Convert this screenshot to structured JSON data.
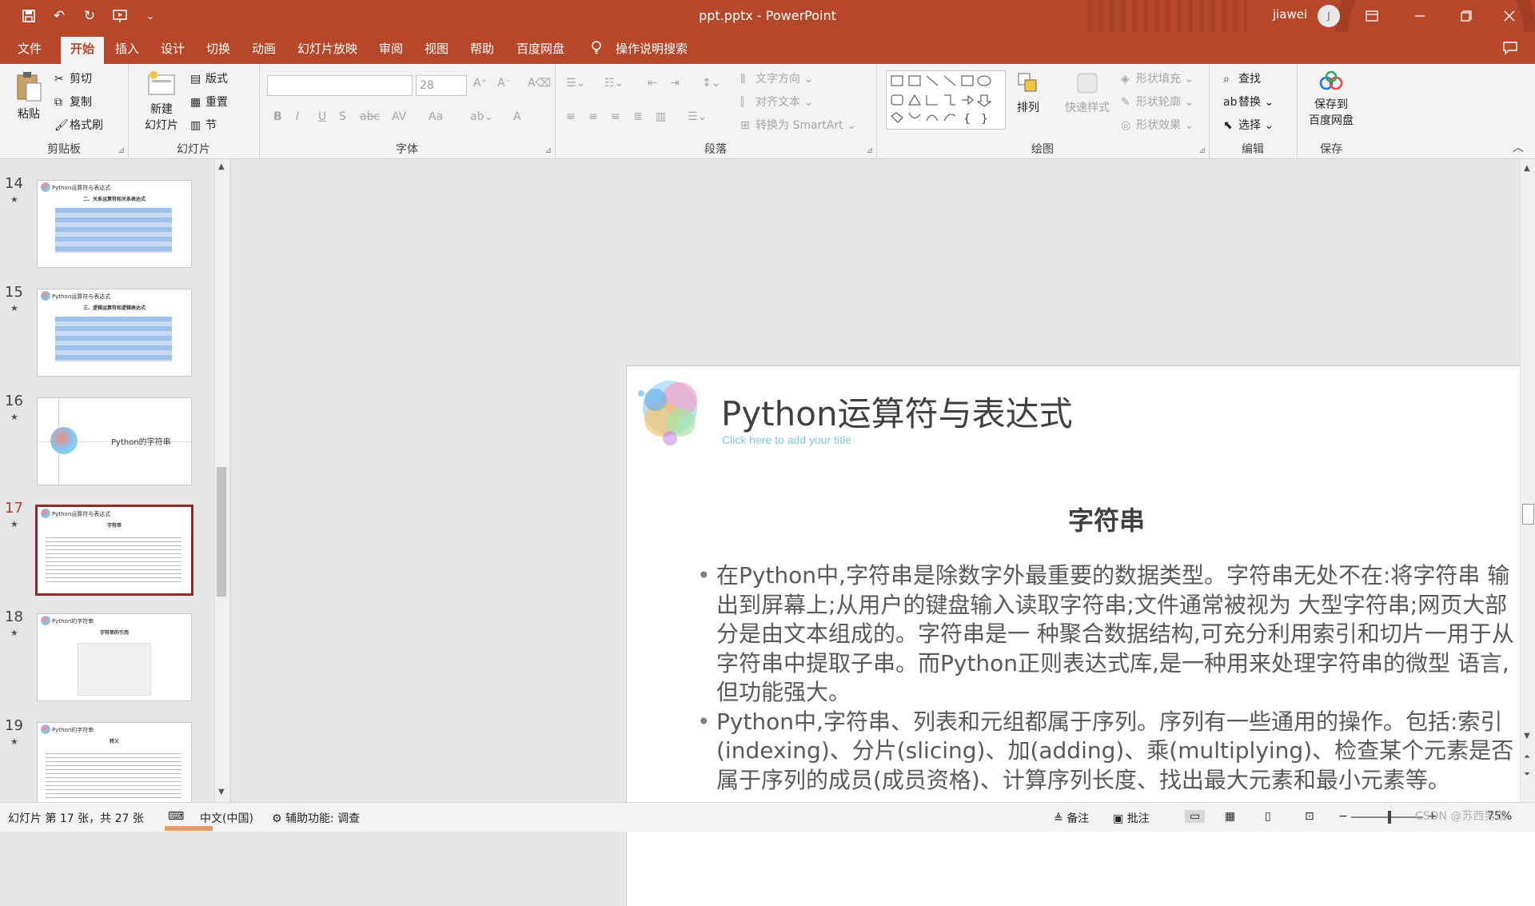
{
  "window": {
    "title": "ppt.pptx  -  PowerPoint",
    "user": "jiawei",
    "avatar_initial": "J",
    "title_bar_color": "#b7472a"
  },
  "quick_access": {
    "icons": [
      "save-icon",
      "undo-icon",
      "redo-icon",
      "from-beginning-icon",
      "customize-icon"
    ],
    "undo_glyph": "↶",
    "redo_glyph": "↻",
    "customize_glyph": "⌄"
  },
  "tabs": [
    "文件",
    "开始",
    "插入",
    "设计",
    "切换",
    "动画",
    "幻灯片放映",
    "审阅",
    "视图",
    "帮助",
    "百度网盘"
  ],
  "active_tab": "开始",
  "tell_me": "操作说明搜索",
  "ribbon": {
    "clipboard": {
      "label": "剪贴板",
      "paste": "粘贴",
      "cut": "剪切",
      "copy": "复制",
      "format_painter": "格式刷"
    },
    "slides": {
      "label": "幻灯片",
      "new_slide_1": "新建",
      "new_slide_2": "幻灯片",
      "layout": "版式",
      "reset": "重置",
      "section": "节"
    },
    "font": {
      "label": "字体",
      "font_name": "",
      "font_size": "28",
      "buttons": [
        "B",
        "I",
        "U",
        "S",
        "abc",
        "AV",
        "Aa",
        "A"
      ]
    },
    "paragraph": {
      "label": "段落",
      "text_direction": "文字方向",
      "align_text": "对齐文本",
      "smartart": "转换为 SmartArt"
    },
    "drawing": {
      "label": "绘图",
      "arrange": "排列",
      "quick_styles": "快速样式",
      "fill": "形状填充",
      "outline": "形状轮廓",
      "effects": "形状效果"
    },
    "editing": {
      "label": "编辑",
      "find": "查找",
      "replace": "替换",
      "select": "选择"
    },
    "save": {
      "label": "保存",
      "save_to_1": "保存到",
      "save_to_2": "百度网盘"
    }
  },
  "thumbnails": [
    {
      "number": "14",
      "title": "Python运算符与表达式",
      "subtitle": "二、关系运算符和关系表达式",
      "kind": "table"
    },
    {
      "number": "15",
      "title": "Python运算符与表达式",
      "subtitle": "三、逻辑运算符和逻辑表达式",
      "kind": "table"
    },
    {
      "number": "16",
      "title": "Python的字符串",
      "subtitle": "",
      "kind": "section"
    },
    {
      "number": "17",
      "title": "Python运算符与表达式",
      "subtitle": "字符串",
      "kind": "text"
    },
    {
      "number": "18",
      "title": "Python的字符串",
      "subtitle": "字符串的引用",
      "kind": "code"
    },
    {
      "number": "19",
      "title": "Python的字符串",
      "subtitle": "转义",
      "kind": "text"
    }
  ],
  "current_slide": {
    "title": "Python运算符与表达式",
    "subtitle_placeholder": "Click here to add your title",
    "heading": "字符串",
    "bullets": [
      "在Python中,字符串是除数字外最重要的数据类型。字符串无处不在:将字符串 输出到屏幕上;从用户的键盘输入读取字符串;文件通常被视为 大型字符串;网页大部分是由文本组成的。字符串是一 种聚合数据结构,可充分利用索引和切片一用于从字符串中提取子串。而Python正则表达式库,是一种用来处理字符串的微型 语言,但功能强大。",
      "Python中,字符串、列表和元组都属于序列。序列有一些通用的操作。包括:索引(indexing)、分片(slicing)、加(adding)、乘(multiplying)、检查某个元素是否属于序列的成员(成员资格)、计算序列长度、找出最大元素和最小元素等。"
    ]
  },
  "status": {
    "slide_info": "幻灯片 第 17 张，共 27 张",
    "language": "中文(中国)",
    "accessibility": "辅助功能: 调查",
    "notes": "备注",
    "comments": "批注",
    "zoom": "75%",
    "watermark": "CSDN @苏西男谐"
  }
}
